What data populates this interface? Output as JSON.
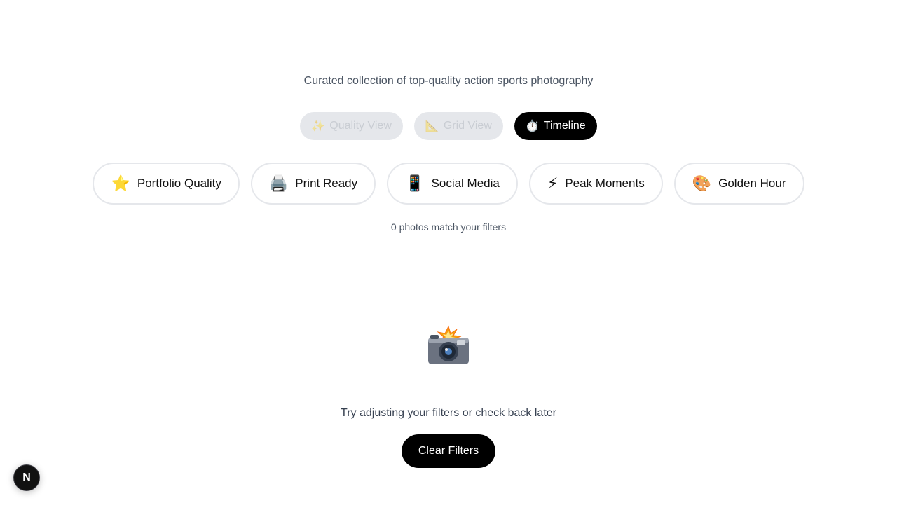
{
  "header": {
    "subtitle": "Curated collection of top-quality action sports photography"
  },
  "view_modes": [
    {
      "icon": "sparkles-icon",
      "emoji": "✨",
      "label": "Quality View",
      "active": false
    },
    {
      "icon": "triangular-ruler-icon",
      "emoji": "📐",
      "label": "Grid View",
      "active": false
    },
    {
      "icon": "stopwatch-icon",
      "emoji": "⏱️",
      "label": "Timeline",
      "active": true
    }
  ],
  "filters": [
    {
      "icon": "star-icon",
      "emoji": "⭐",
      "label": "Portfolio Quality"
    },
    {
      "icon": "printer-icon",
      "emoji": "🖨️",
      "label": "Print Ready"
    },
    {
      "icon": "mobile-phone-icon",
      "emoji": "📱",
      "label": "Social Media"
    },
    {
      "icon": "lightning-icon",
      "emoji": "⚡",
      "label": "Peak Moments"
    },
    {
      "icon": "palette-icon",
      "emoji": "🎨",
      "label": "Golden Hour"
    }
  ],
  "results": {
    "count_text": "0 photos match your filters"
  },
  "empty_state": {
    "icon": "camera-flash-icon",
    "message": "Try adjusting your filters or check back later",
    "clear_label": "Clear Filters"
  },
  "dev_badge": {
    "letter": "N",
    "icon": "nextjs-logo-icon"
  },
  "colors": {
    "accent": "#000000",
    "muted_text": "#4b5563",
    "chip_border": "#e5e7eb",
    "inactive_bg": "#e5e7eb"
  }
}
